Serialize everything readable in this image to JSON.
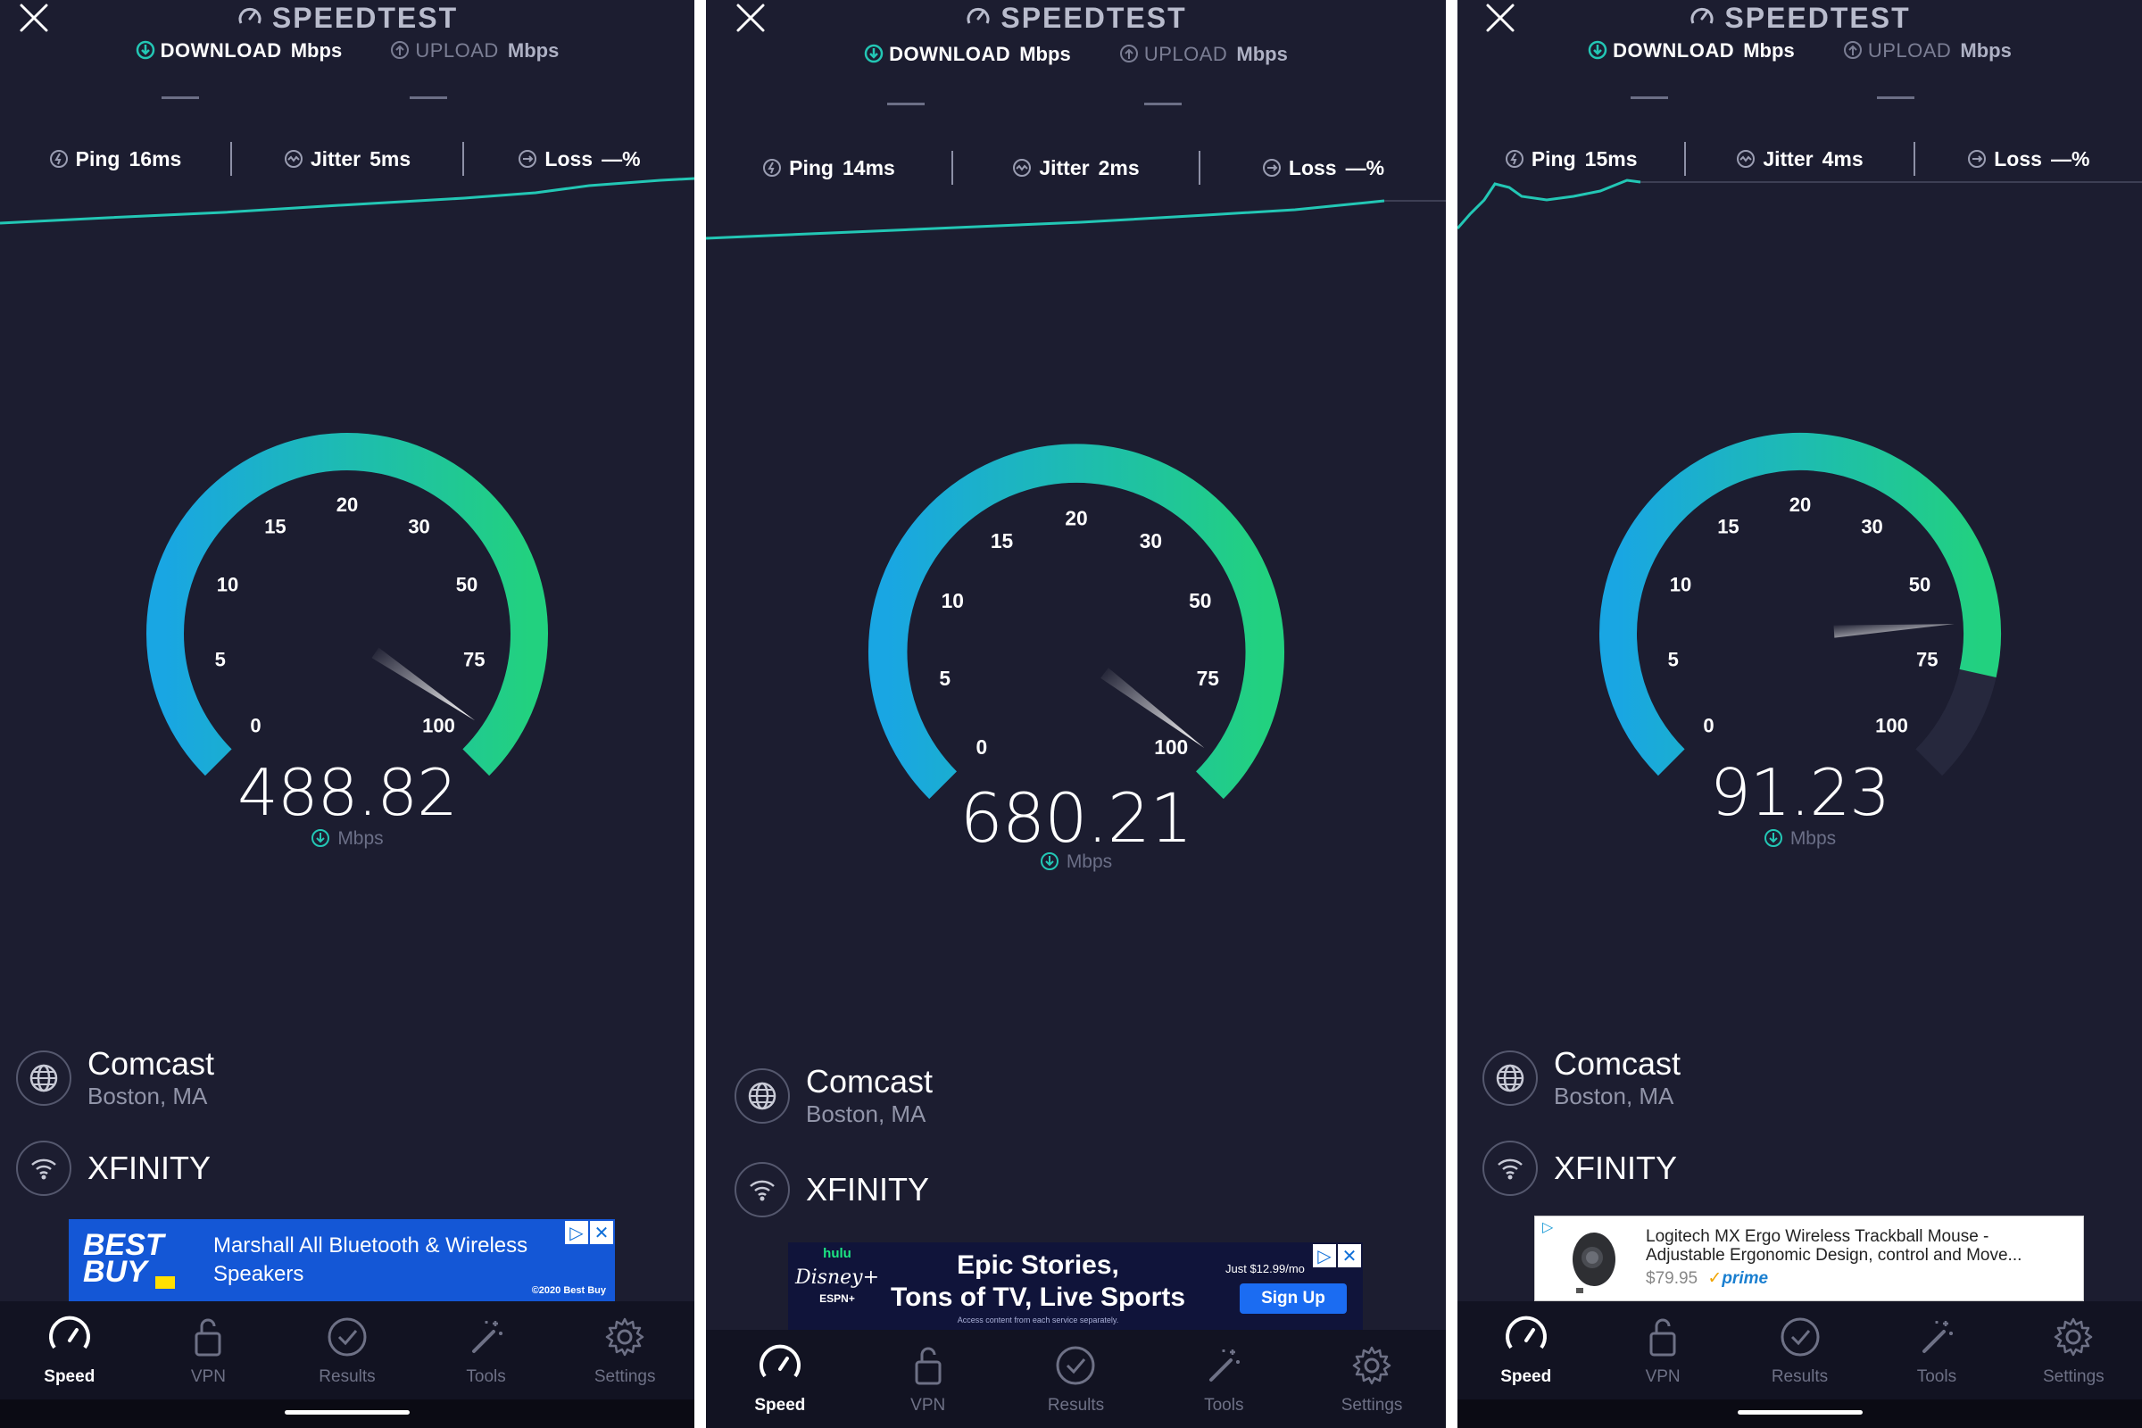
{
  "colors": {
    "panel_bg": "#1c1d30",
    "gauge_start": "#19a6e3",
    "gauge_end": "#22d17f",
    "needle": "#ffffff",
    "accent": "#23c7b5"
  },
  "panels": [
    {
      "app_title": "SPEEDTEST",
      "modes": {
        "download_label": "DOWNLOAD",
        "download_unit": "Mbps",
        "upload_label": "UPLOAD",
        "upload_unit": "Mbps"
      },
      "stats": {
        "ping_label": "Ping",
        "ping_value": "16ms",
        "jitter_label": "Jitter",
        "jitter_value": "5ms",
        "loss_label": "Loss",
        "loss_value": "—%"
      },
      "gauge": {
        "ticks": [
          "0",
          "5",
          "10",
          "15",
          "20",
          "30",
          "50",
          "75",
          "100"
        ],
        "needle_fraction": 0.96,
        "fill_fraction": 1.0
      },
      "speed_value": "488.82",
      "speed_unit": "Mbps",
      "isp": {
        "name": "Comcast",
        "location": "Boston, MA"
      },
      "network": "XFINITY",
      "ad": {
        "brand_line1": "BEST",
        "brand_line2": "BUY",
        "text": "Marshall All Bluetooth & Wireless Speakers",
        "fine_print": "©2020 Best Buy"
      },
      "tabs": [
        "Speed",
        "VPN",
        "Results",
        "Tools",
        "Settings"
      ]
    },
    {
      "app_title": "SPEEDTEST",
      "modes": {
        "download_label": "DOWNLOAD",
        "download_unit": "Mbps",
        "upload_label": "UPLOAD",
        "upload_unit": "Mbps"
      },
      "stats": {
        "ping_label": "Ping",
        "ping_value": "14ms",
        "jitter_label": "Jitter",
        "jitter_value": "2ms",
        "loss_label": "Loss",
        "loss_value": "—%"
      },
      "gauge": {
        "ticks": [
          "0",
          "5",
          "10",
          "15",
          "20",
          "30",
          "50",
          "75",
          "100"
        ],
        "needle_fraction": 0.97,
        "fill_fraction": 1.0
      },
      "speed_value": "680.21",
      "speed_unit": "Mbps",
      "isp": {
        "name": "Comcast",
        "location": "Boston, MA"
      },
      "network": "XFINITY",
      "ad": {
        "brand_top": "hulu",
        "brand_mid": "Disney+",
        "brand_bottom": "ESPN+",
        "headline1": "Epic Stories,",
        "headline2": "Tons of TV, Live Sports",
        "price": "Just $12.99/mo",
        "cta": "Sign Up",
        "fine_print": "Access content from each service separately."
      },
      "tabs": [
        "Speed",
        "VPN",
        "Results",
        "Tools",
        "Settings"
      ]
    },
    {
      "app_title": "SPEEDTEST",
      "modes": {
        "download_label": "DOWNLOAD",
        "download_unit": "Mbps",
        "upload_label": "UPLOAD",
        "upload_unit": "Mbps"
      },
      "stats": {
        "ping_label": "Ping",
        "ping_value": "15ms",
        "jitter_label": "Jitter",
        "jitter_value": "4ms",
        "loss_label": "Loss",
        "loss_value": "—%"
      },
      "gauge": {
        "ticks": [
          "0",
          "5",
          "10",
          "15",
          "20",
          "30",
          "50",
          "75",
          "100"
        ],
        "needle_fraction": 0.82,
        "fill_fraction": 0.88
      },
      "speed_value": "91.23",
      "speed_unit": "Mbps",
      "isp": {
        "name": "Comcast",
        "location": "Boston, MA"
      },
      "network": "XFINITY",
      "ad": {
        "title": "Logitech MX Ergo Wireless Trackball Mouse - Adjustable Ergonomic Design, control and Move...",
        "price": "$79.95",
        "prime": "prime"
      },
      "tabs": [
        "Speed",
        "VPN",
        "Results",
        "Tools",
        "Settings"
      ]
    }
  ]
}
